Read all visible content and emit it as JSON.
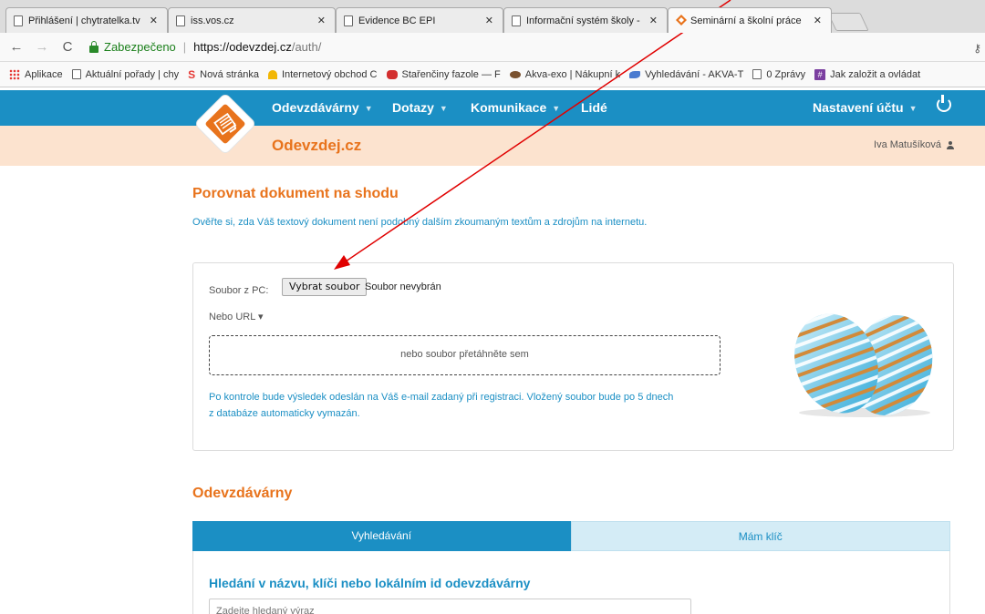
{
  "browser": {
    "tabs": [
      {
        "title": "Přihlášení | chytratelka.tv"
      },
      {
        "title": "iss.vos.cz"
      },
      {
        "title": "Evidence BC EPI"
      },
      {
        "title": "Informační systém školy -"
      },
      {
        "title": "Seminární a školní práce"
      }
    ],
    "close_glyph": "✕",
    "nav": {
      "back": "←",
      "forward": "→",
      "reload": "C",
      "key": "⚷"
    },
    "address": {
      "secure_label": "Zabezpečeno",
      "separator": "|",
      "host": "https://odevzdej.cz",
      "path": "/auth/"
    },
    "bookmarks": [
      {
        "label": "Aplikace",
        "icon": "apps-icon"
      },
      {
        "label": "Aktuální pořady | chy",
        "icon": "page-icon"
      },
      {
        "label": "Nová stránka",
        "icon": "s-icon"
      },
      {
        "label": "Internetový obchod C",
        "icon": "hat-icon"
      },
      {
        "label": "Stařenčiny fazole — F",
        "icon": "bean-icon"
      },
      {
        "label": "Akva-exo | Nákupní k",
        "icon": "fish-icon"
      },
      {
        "label": "Vyhledávání - AKVA-T",
        "icon": "bird-icon"
      },
      {
        "label": "0 Zprávy",
        "icon": "page-icon"
      },
      {
        "label": "Jak založit a ovládat",
        "icon": "hash-icon"
      }
    ]
  },
  "site": {
    "nav": {
      "submissions": "Odevzdávárny",
      "questions": "Dotazy",
      "communication": "Komunikace",
      "people": "Lidé",
      "account": "Nastavení účtu",
      "caret": "▼"
    },
    "brand": "Odevzdej.cz",
    "user": "Iva Matušíková",
    "colors": {
      "accent": "#1b8fc4",
      "brand": "#e8731c",
      "subbar": "#fce3cf"
    }
  },
  "compare": {
    "title": "Porovnat dokument na shodu",
    "description": "Ověřte si, zda Váš textový dokument není podobný dalším zkoumaným textům a zdrojům na internetu.",
    "file_label": "Soubor z PC:",
    "file_button": "Vybrat soubor",
    "file_status": "Soubor nevybrán",
    "url_toggle": "Nebo URL ▾",
    "dropzone": "nebo soubor přetáhněte sem",
    "info_line1": "Po kontrole bude výsledek odeslán na Váš e-mail zadaný při registraci. Vložený soubor bude po 5 dnech",
    "info_line2": "z databáze automaticky vymazán."
  },
  "submissions": {
    "title": "Odevzdávárny",
    "tabs": {
      "search": "Vyhledávání",
      "key": "Mám klíč"
    },
    "search_title": "Hledání v názvu, klíči nebo lokálním id odevzdávárny",
    "search_placeholder": "Zadejte hledaný výraz"
  }
}
